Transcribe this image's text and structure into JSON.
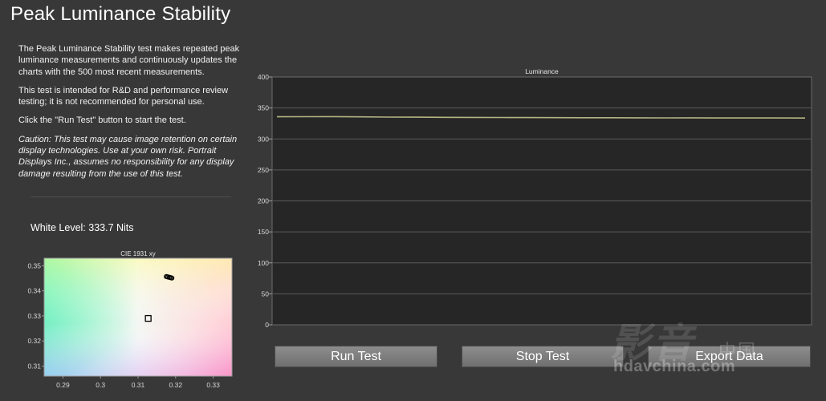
{
  "page": {
    "title": "Peak Luminance Stability",
    "description": [
      "The Peak Luminance Stability test makes repeated peak luminance measurements and continuously updates the charts with the 500 most recent measurements.",
      "This test is intended for R&D and performance review testing; it is not recommended for personal use.",
      "Click the \"Run Test\" button to start the test."
    ],
    "caution": "Caution: This test may cause image retention on certain display technologies. Use at your own risk. Portrait Displays Inc., assumes no responsibility for any display damage resulting from the use of this test.",
    "white_level": "White Level: 333.7 Nits"
  },
  "buttons": {
    "run": "Run Test",
    "stop": "Stop Test",
    "export": "Export Data"
  },
  "watermark": {
    "brand": "影音",
    "cn": "中国",
    "url": "hdavchina.com"
  },
  "colors": {
    "line": "#b3b383",
    "plot_bg": "#262626",
    "grid": "#5a5a5a",
    "button": "#7e7e7e"
  },
  "chart_data": [
    {
      "type": "line",
      "title": "Luminance",
      "ylim": [
        0,
        400
      ],
      "yticks": [
        0,
        50,
        100,
        150,
        200,
        250,
        300,
        350,
        400
      ],
      "grid": true,
      "series": [
        {
          "values": [
            335.8,
            335.9,
            336.0,
            335.6,
            335.3,
            335.1,
            334.9,
            334.8,
            334.6,
            334.5,
            334.4,
            334.3,
            334.2,
            334.1,
            334.0,
            334.1,
            333.9,
            333.8,
            333.9,
            333.7
          ]
        }
      ]
    },
    {
      "type": "scatter",
      "title": "CIE 1931 xy",
      "xlim": [
        0.285,
        0.335
      ],
      "ylim": [
        0.306,
        0.353
      ],
      "xticks": [
        0.29,
        0.3,
        0.31,
        0.32,
        0.33
      ],
      "yticks": [
        0.31,
        0.32,
        0.33,
        0.34,
        0.35
      ],
      "target_white_point": [
        0.3127,
        0.329
      ],
      "series": [
        {
          "x": [
            0.3175,
            0.3178,
            0.318,
            0.3183,
            0.3185,
            0.3188,
            0.319
          ],
          "y": [
            0.3457,
            0.3456,
            0.3455,
            0.3454,
            0.3453,
            0.3452,
            0.3451
          ]
        }
      ]
    }
  ]
}
